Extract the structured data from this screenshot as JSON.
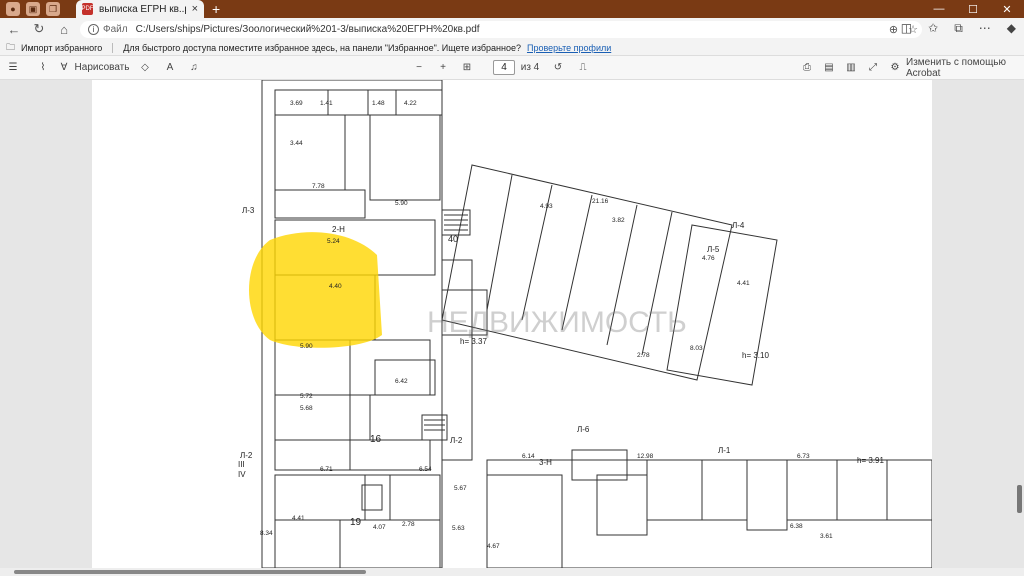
{
  "browser": {
    "tab_title": "выписка ЕГРН кв..pdf",
    "file_label": "Файл",
    "url": "C:/Users/ships/Pictures/Зоологический%201-3/выписка%20ЕГРН%20кв.pdf",
    "new_tab_symbol": "+",
    "close_symbol": "×"
  },
  "favorites": {
    "import_label": "Импорт избранного",
    "hint": "Для быстрого доступа поместите избранное здесь, на панели \"Избранное\". Ищете избранное?",
    "link": "Проверьте профили"
  },
  "pdf_toolbar": {
    "draw_label": "Нарисовать",
    "zoom_minus": "−",
    "zoom_plus": "+",
    "page_current": "4",
    "page_total": "из 4",
    "acrobat_label": "Изменить с помощью Acrobat"
  },
  "floorplan": {
    "labels": [
      "Л-3",
      "2-Н",
      "Л-2",
      "Л-4",
      "Л-5",
      "Л-6",
      "Л-1",
      "3-Н",
      "16",
      "19",
      "40",
      "III",
      "IV"
    ],
    "heights": [
      "h= 3.37",
      "h= 3.10",
      "h= 3.91"
    ],
    "dimensions": [
      "3.69",
      "1.41",
      "1.48",
      "4.22",
      "3.44",
      "7.78",
      "5.90",
      "5.24",
      "4.40",
      "5.90",
      "5.72",
      "5.68",
      "6.71",
      "6.54",
      "6.42",
      "4.41",
      "4.07",
      "2.78",
      "5.63",
      "5.67",
      "4.67",
      "21.16",
      "4.93",
      "3.82",
      "4.76",
      "4.41",
      "8.03",
      "2.78",
      "6.14",
      "12.98",
      "6.73",
      "6.38",
      "3.61",
      "8.34"
    ],
    "watermark": "НЕДВИЖИМОСТЬ"
  },
  "colors": {
    "titlebar": "#7a3a14",
    "highlight": "#ffd600"
  },
  "icons": [
    "profile-icon",
    "workspaces-icon",
    "tabs-icon",
    "pdf-icon",
    "back-icon",
    "refresh-icon",
    "home-icon",
    "info-icon",
    "zoom-icon",
    "star-icon",
    "split-icon",
    "favorites-icon",
    "collections-icon",
    "menu-icon",
    "copilot-icon"
  ]
}
